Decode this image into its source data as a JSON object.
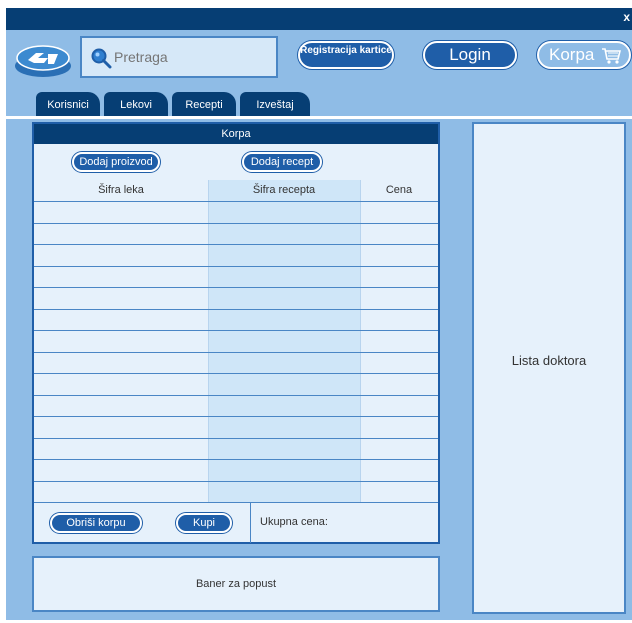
{
  "titlebar": {
    "close_label": "x"
  },
  "search": {
    "placeholder": "Pretraga"
  },
  "header": {
    "register_label": "Registracija kartice",
    "login_label": "Login",
    "cart_label": "Korpa"
  },
  "tabs": [
    {
      "label": "Korisnici"
    },
    {
      "label": "Lekovi"
    },
    {
      "label": "Recepti"
    },
    {
      "label": "Izveštaj"
    }
  ],
  "cart": {
    "title": "Korpa",
    "add_product_label": "Dodaj proizvod",
    "add_recipe_label": "Dodaj recept",
    "columns": [
      "Šifra leka",
      "Šifra recepta",
      "Cena"
    ],
    "rows": [],
    "clear_label": "Obriši korpu",
    "buy_label": "Kupi",
    "total_label": "Ukupna cena:"
  },
  "banner": {
    "text": "Baner za popust"
  },
  "doctors": {
    "title": "Lista doktora"
  },
  "colors": {
    "titlebar": "#063e74",
    "background": "#8fbce6",
    "button": "#1f5ea8",
    "panel": "#e6f1fb"
  }
}
